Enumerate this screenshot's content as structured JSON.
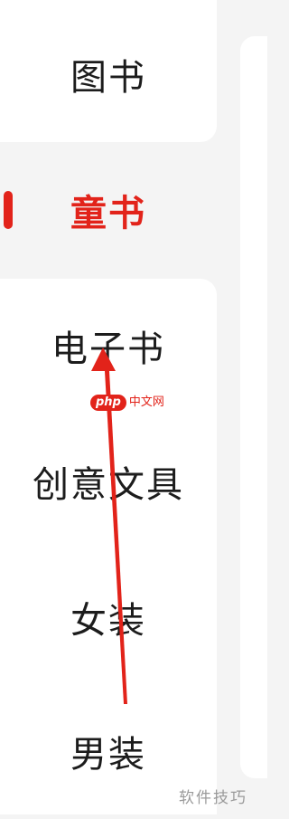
{
  "sidebar": {
    "items": [
      {
        "label": "图书",
        "selected": false
      },
      {
        "label": "童书",
        "selected": true
      },
      {
        "label": "电子书",
        "selected": false
      },
      {
        "label": "创意文具",
        "selected": false
      },
      {
        "label": "女装",
        "selected": false
      },
      {
        "label": "男装",
        "selected": false
      }
    ]
  },
  "watermarks": {
    "center_logo": "php",
    "center_text": "中文网",
    "corner_text": "软件技巧"
  },
  "annotation": {
    "type": "arrow",
    "color": "#e2231a",
    "points_to": "电子书"
  },
  "colors": {
    "accent": "#e2231a",
    "background": "#f4f4f4",
    "card": "#ffffff",
    "text": "#1c1c1c"
  }
}
